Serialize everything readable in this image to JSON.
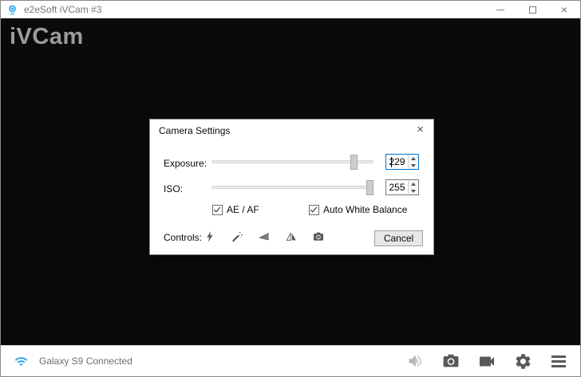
{
  "titlebar": {
    "app_title": "e2eSoft iVCam #3",
    "close_label": "×"
  },
  "video": {
    "watermark": "iVCam"
  },
  "dialog": {
    "title": "Camera Settings",
    "close_label": "×",
    "exposure": {
      "label": "Exposure:",
      "value": "229",
      "max": 255
    },
    "iso": {
      "label": "ISO:",
      "value": "255",
      "max": 255
    },
    "checkboxes": {
      "ae_af": {
        "label": "AE / AF",
        "checked": true
      },
      "awb": {
        "label": "Auto White Balance",
        "checked": true
      }
    },
    "controls_label": "Controls:",
    "control_icons": [
      "flash-icon",
      "beauty-wand-icon",
      "flip-vertical-icon",
      "flip-horizontal-icon",
      "snapshot-icon"
    ],
    "cancel_label": "Cancel"
  },
  "statusbar": {
    "status_text": "Galaxy S9 Connected",
    "icons": [
      "wifi-icon",
      "volume-icon",
      "photo-capture-icon",
      "video-record-icon",
      "settings-gear-icon",
      "menu-icon"
    ]
  },
  "colors": {
    "focus_blue": "#0078d7",
    "wifi_blue": "#38a1e4",
    "icon_gray": "#595959",
    "muted_icon_gray": "#b5b5b5",
    "watermark_gray": "#9b9b9b"
  }
}
